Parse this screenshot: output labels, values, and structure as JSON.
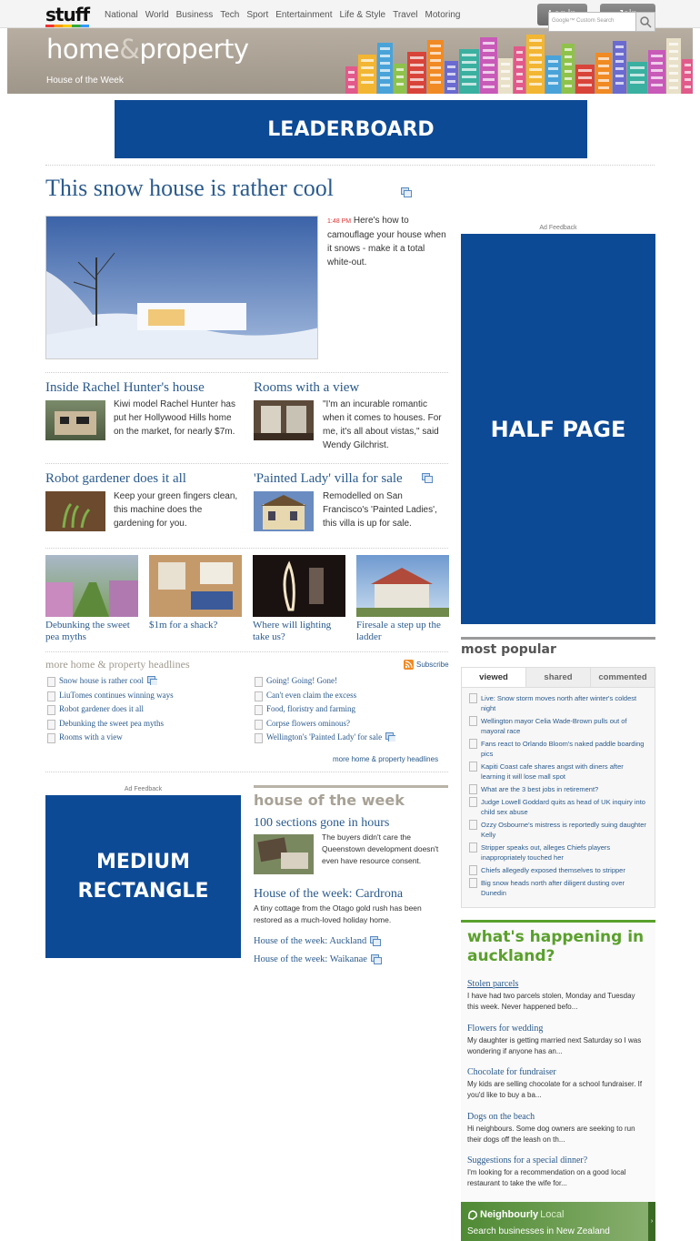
{
  "top_nav": {
    "logo": "stuff",
    "links": [
      "National",
      "World",
      "Business",
      "Tech",
      "Sport",
      "Entertainment",
      "Life & Style",
      "Travel",
      "Motoring"
    ],
    "login_label": "Log in",
    "join_label": "Join"
  },
  "header": {
    "brand_home": "home",
    "brand_amp": "&",
    "brand_property": "property",
    "section": "House of the Week",
    "search_placeholder": "Google™ Custom Search"
  },
  "ads": {
    "leaderboard": "LEADERBOARD",
    "half_page": "HALF PAGE",
    "medium_rect_1": "MEDIUM",
    "medium_rect_2": "RECTANGLE",
    "feedback": "Ad Feedback"
  },
  "lead": {
    "title": "This snow house is rather cool",
    "time": "1:48 PM",
    "summary": "Here's how to camouflage your house when it snows - make it a total white-out."
  },
  "stories": [
    {
      "title": "Inside Rachel Hunter's house",
      "text": "Kiwi model Rachel Hunter has put her Hollywood Hills home on the market, for nearly $7m."
    },
    {
      "title": "Rooms with a view",
      "text": "\"I'm an incurable romantic when it comes to houses. For me, it's all about vistas,\" said Wendy Gilchrist."
    },
    {
      "title": "Robot gardener does it all",
      "text": "Keep your green fingers clean, this machine does the gardening for you."
    },
    {
      "title": "'Painted Lady' villa for sale",
      "text": "Remodelled on San Francisco's 'Painted Ladies', this villa is up for sale."
    }
  ],
  "strip": [
    {
      "caption": "Debunking the sweet pea myths"
    },
    {
      "caption": "$1m for a shack?"
    },
    {
      "caption": "Where will lighting take us?"
    },
    {
      "caption": "Firesale a step up the ladder"
    }
  ],
  "headlines": {
    "title": "more home & property headlines",
    "subscribe": "Subscribe",
    "left": [
      "Snow house is rather cool",
      "LiuTomes continues winning ways",
      "Robot gardener does it all",
      "Debunking the sweet pea myths",
      "Rooms with a view"
    ],
    "right": [
      "Going! Going! Gone!",
      "Can't even claim the excess",
      "Food, floristry and farming",
      "Corpse flowers ominous?",
      "Wellington's 'Painted Lady' for sale"
    ],
    "more_link": "more home & property headlines"
  },
  "house_of_week": {
    "title": "house of the week",
    "lead_title": "100 sections gone in hours",
    "lead_text": "The buyers didn't care the Queenstown development doesn't even have resource consent.",
    "second_title": "House of the week: Cardrona",
    "second_text": "A tiny cottage from the Otago gold rush has been restored as a much-loved holiday home.",
    "links": [
      "House of the week: Auckland",
      "House of the week: Waikanae"
    ]
  },
  "most_popular": {
    "title": "most popular",
    "tabs": [
      "viewed",
      "shared",
      "commented"
    ],
    "items": [
      "Live: Snow storm moves north after winter's coldest night",
      "Wellington mayor Celia Wade-Brown pulls out of mayoral race",
      "Fans react to Orlando Bloom's naked paddle boarding pics",
      "Kapiti Coast cafe shares angst with diners after learning it will lose mall spot",
      "What are the 3 best jobs in retirement?",
      "Judge Lowell Goddard quits as head of UK inquiry into child sex abuse",
      "Ozzy Osbourne's mistress is reportedly suing daughter Kelly",
      "Stripper speaks out, alleges Chiefs players inappropriately touched her",
      "Chiefs allegedly exposed themselves to stripper",
      "Big snow heads north after diligent dusting over Dunedin"
    ]
  },
  "happening": {
    "title_line1": "what's happening in",
    "title_line2": "auckland?",
    "items": [
      {
        "title": "Stolen parcels",
        "text": "I have had two parcels stolen, Monday and Tuesday this week. Never happened befo..."
      },
      {
        "title": "Flowers for wedding",
        "text": "My daughter is getting married next Saturday so I was wondering if anyone has an..."
      },
      {
        "title": "Chocolate for fundraiser",
        "text": "My kids are selling chocolate for a school fundraiser. If you'd like to buy a ba..."
      },
      {
        "title": "Dogs on the beach",
        "text": "Hi neighbours. Some dog owners are seeking to run their dogs off the leash on th..."
      },
      {
        "title": "Suggestions for a special dinner?",
        "text": "I'm looking for a recommendation on a good local restaurant to take the wife for..."
      }
    ]
  },
  "neighbourly": {
    "brand": "Neighbourly",
    "brand_suffix": "Local",
    "tagline": "Search businesses in New Zealand"
  },
  "colors": {
    "ad_blue": "#0d4a95",
    "link": "#2a5a8c",
    "happening_green": "#5aa02c"
  }
}
